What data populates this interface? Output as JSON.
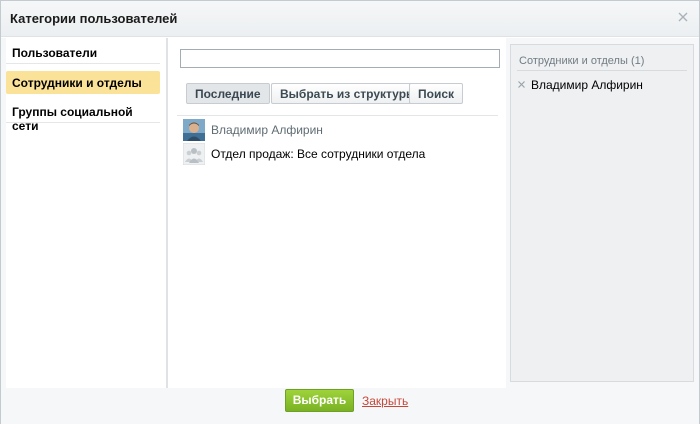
{
  "dialog": {
    "title": "Категории пользователей"
  },
  "nav": {
    "items": [
      {
        "label": "Пользователи",
        "active": false
      },
      {
        "label": "Сотрудники и отделы",
        "active": true
      },
      {
        "label": "Группы социальной сети",
        "active": false
      }
    ]
  },
  "search": {
    "value": "",
    "placeholder": ""
  },
  "tabs": {
    "recent": "Последние",
    "structure": "Выбрать из структуры",
    "search": "Поиск"
  },
  "list": {
    "items": [
      {
        "label": "Владимир Алфирин",
        "icon": "user-avatar"
      },
      {
        "label": "Отдел продаж: Все сотрудники отдела",
        "icon": "department-icon"
      }
    ]
  },
  "selected": {
    "header": "Сотрудники и отделы (1)",
    "items": [
      {
        "label": "Владимир Алфирин"
      }
    ]
  },
  "footer": {
    "select_label": "Выбрать",
    "close_label": "Закрыть"
  },
  "colors": {
    "active_nav": "#fbe299",
    "select_button": "#8cc432",
    "close_link": "#c6483a"
  }
}
